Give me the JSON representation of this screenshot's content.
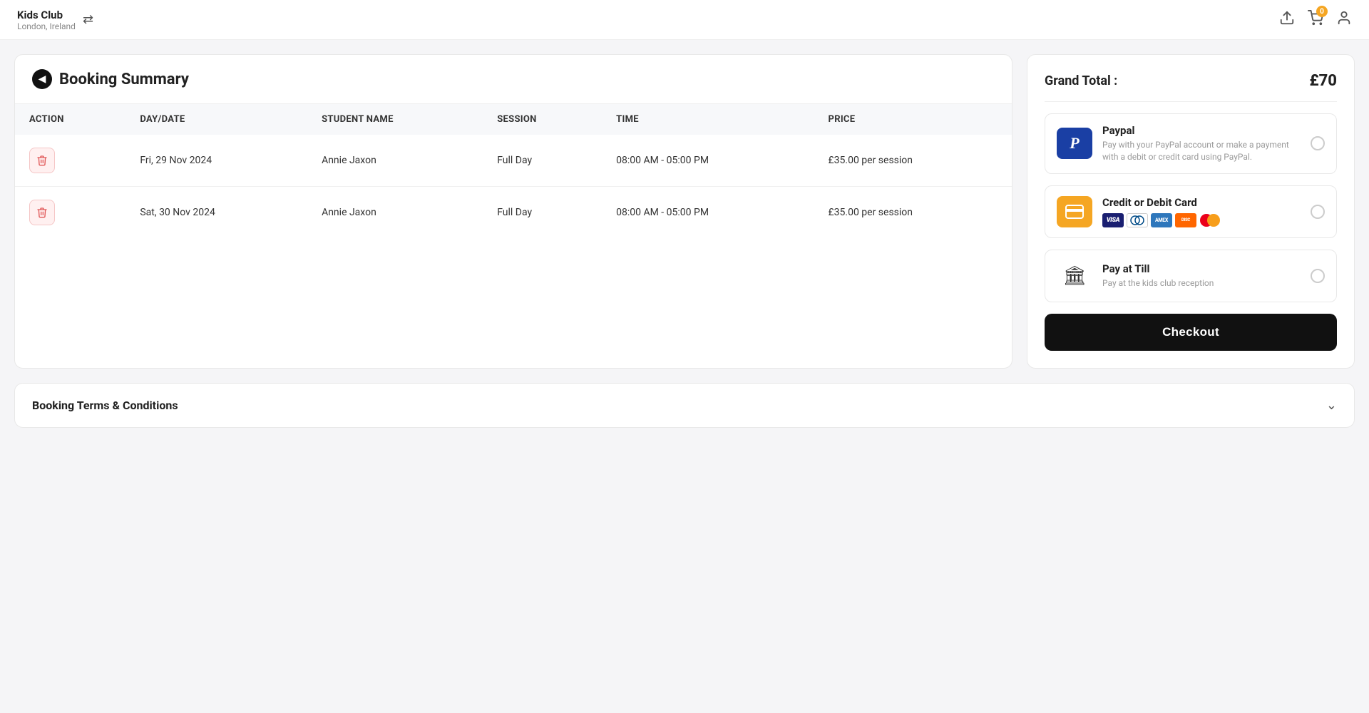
{
  "header": {
    "brand_name": "Kids Club",
    "brand_location": "London, Ireland",
    "back_label": "←",
    "cart_badge": "0"
  },
  "booking_summary": {
    "title": "Booking Summary",
    "columns": [
      "ACTION",
      "DAY/DATE",
      "STUDENT NAME",
      "SESSION",
      "TIME",
      "PRICE"
    ],
    "rows": [
      {
        "day_date": "Fri, 29 Nov 2024",
        "student_name": "Annie Jaxon",
        "session": "Full Day",
        "time": "08:00 AM - 05:00 PM",
        "price": "£35.00 per session"
      },
      {
        "day_date": "Sat, 30 Nov 2024",
        "student_name": "Annie Jaxon",
        "session": "Full Day",
        "time": "08:00 AM - 05:00 PM",
        "price": "£35.00 per session"
      }
    ]
  },
  "payment": {
    "grand_total_label": "Grand Total :",
    "grand_total_amount": "£70",
    "options": [
      {
        "name": "Paypal",
        "description": "Pay with your PayPal account or make a payment with a debit or credit card using PayPal.",
        "type": "paypal"
      },
      {
        "name": "Credit or Debit Card",
        "description": "",
        "type": "card"
      },
      {
        "name": "Pay at Till",
        "description": "Pay at the kids club reception",
        "type": "till"
      }
    ],
    "checkout_label": "Checkout"
  },
  "terms": {
    "label": "Booking Terms & Conditions"
  }
}
